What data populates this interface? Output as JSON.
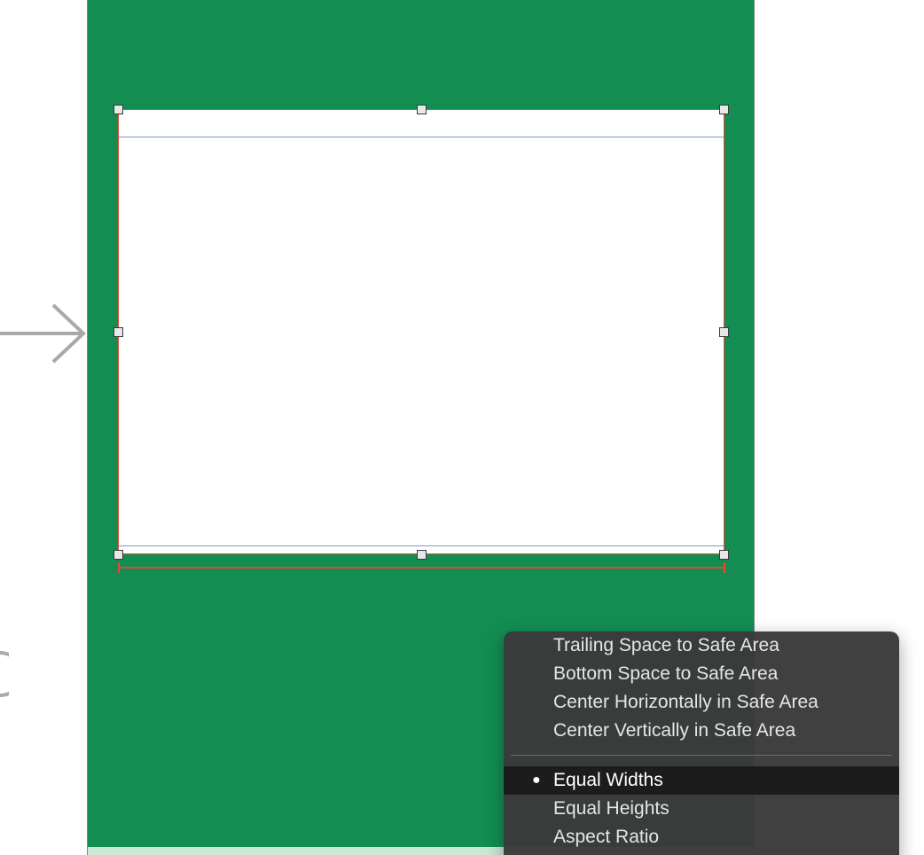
{
  "canvas": {
    "background_color": "#ffffff",
    "scene_background_color": "#138d52",
    "selection_border_color": "#e24a33",
    "guide_color": "#7f97d6"
  },
  "entry_point": {
    "icon": "arrow-right-icon"
  },
  "context_menu": {
    "items_top": [
      {
        "label": "Trailing Space to Safe Area"
      },
      {
        "label": "Bottom Space to Safe Area"
      },
      {
        "label": "Center Horizontally in Safe Area"
      },
      {
        "label": "Center Vertically in Safe Area"
      }
    ],
    "items_bottom": [
      {
        "label": "Equal Widths",
        "selected": true,
        "bullet": "●"
      },
      {
        "label": "Equal Heights",
        "selected": false
      },
      {
        "label": "Aspect Ratio",
        "selected": false
      }
    ]
  }
}
